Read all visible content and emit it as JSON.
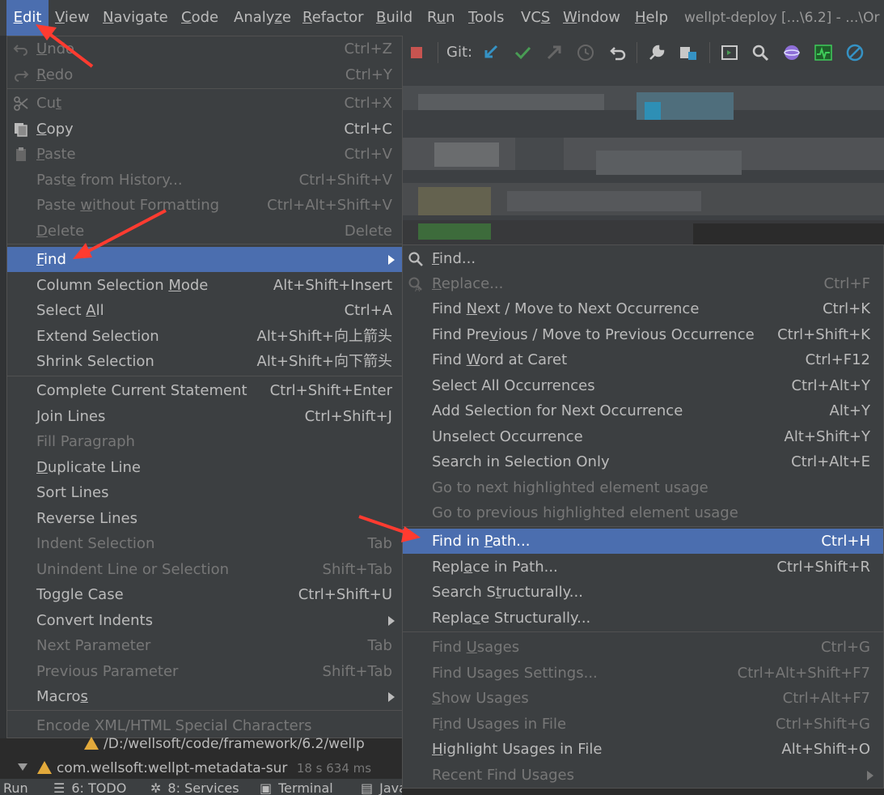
{
  "menubar": {
    "items": [
      {
        "label_u": "E",
        "label_rest": "dit",
        "active": true
      },
      {
        "label_u": "V",
        "label_rest": "iew"
      },
      {
        "label_u": "N",
        "label_rest": "avigate"
      },
      {
        "label_u": "C",
        "label_rest": "ode"
      },
      {
        "label_pre": "Analy",
        "label_u": "z",
        "label_rest": "e"
      },
      {
        "label_u": "R",
        "label_rest": "efactor"
      },
      {
        "label_u": "B",
        "label_rest": "uild"
      },
      {
        "label_pre": "R",
        "label_u": "u",
        "label_rest": "n"
      },
      {
        "label_u": "T",
        "label_rest": "ools"
      },
      {
        "label_pre": "VC",
        "label_u": "S",
        "label_rest": ""
      },
      {
        "label_u": "W",
        "label_rest": "indow"
      },
      {
        "label_u": "H",
        "label_rest": "elp"
      }
    ],
    "title": "wellpt-deploy [...\\6.2] - ...\\Or"
  },
  "toolbar": {
    "git_label": "Git:",
    "icons": [
      "stop-icon",
      "git-update-icon",
      "git-commit-icon",
      "git-push-icon",
      "git-history-icon",
      "git-rollback-icon",
      "settings-wrench-icon",
      "project-structure-icon",
      "run-anything-icon",
      "search-everywhere-icon",
      "plugin-sphere-icon",
      "activity-monitor-icon",
      "disable-icon"
    ]
  },
  "edit_menu": {
    "items": [
      {
        "pre": "",
        "u": "U",
        "rest": "ndo",
        "shortcut": "Ctrl+Z",
        "disabled": true,
        "icon": "undo-icon"
      },
      {
        "pre": "",
        "u": "R",
        "rest": "edo",
        "shortcut": "Ctrl+Y",
        "disabled": true,
        "icon": "redo-icon"
      },
      {
        "pre": "Cu",
        "u": "t",
        "rest": "",
        "shortcut": "Ctrl+X",
        "disabled": true,
        "icon": "scissors-icon"
      },
      {
        "pre": "",
        "u": "C",
        "rest": "opy",
        "shortcut": "Ctrl+C",
        "disabled": false,
        "icon": "copy-icon"
      },
      {
        "pre": "",
        "u": "P",
        "rest": "aste",
        "shortcut": "Ctrl+V",
        "disabled": true,
        "icon": "clipboard-icon"
      },
      {
        "pre": "Past",
        "u": "e",
        "rest": " from History...",
        "shortcut": "Ctrl+Shift+V",
        "disabled": true
      },
      {
        "pre": "Paste ",
        "u": "w",
        "rest": "ithout Formatting",
        "shortcut": "Ctrl+Alt+Shift+V",
        "disabled": true
      },
      {
        "pre": "",
        "u": "D",
        "rest": "elete",
        "shortcut": "Delete",
        "disabled": true
      },
      {
        "pre": "",
        "u": "F",
        "rest": "ind",
        "shortcut": "",
        "selected": true,
        "submenu": true
      },
      {
        "pre": "Column Selection ",
        "u": "M",
        "rest": "ode",
        "shortcut": "Alt+Shift+Insert"
      },
      {
        "pre": "Select ",
        "u": "A",
        "rest": "ll",
        "shortcut": "Ctrl+A"
      },
      {
        "pre": "Extend Selection",
        "u": "",
        "rest": "",
        "shortcut": "Alt+Shift+向上箭头"
      },
      {
        "pre": "Shrink Selection",
        "u": "",
        "rest": "",
        "shortcut": "Alt+Shift+向下箭头"
      },
      {
        "pre": "Complete Current Statement",
        "u": "",
        "rest": "",
        "shortcut": "Ctrl+Shift+Enter"
      },
      {
        "pre": "Join Lines",
        "u": "",
        "rest": "",
        "shortcut": "Ctrl+Shift+J"
      },
      {
        "pre": "Fill Paragraph",
        "u": "",
        "rest": "",
        "shortcut": "",
        "disabled": true
      },
      {
        "pre": "",
        "u": "D",
        "rest": "uplicate Line",
        "shortcut": ""
      },
      {
        "pre": "Sort Lines",
        "u": "",
        "rest": "",
        "shortcut": ""
      },
      {
        "pre": "Reverse Lines",
        "u": "",
        "rest": "",
        "shortcut": ""
      },
      {
        "pre": "Indent Selection",
        "u": "",
        "rest": "",
        "shortcut": "Tab",
        "disabled": true
      },
      {
        "pre": "Unindent Line or Selection",
        "u": "",
        "rest": "",
        "shortcut": "Shift+Tab",
        "disabled": true
      },
      {
        "pre": "Toggle Case",
        "u": "",
        "rest": "",
        "shortcut": "Ctrl+Shift+U"
      },
      {
        "pre": "Convert Indents",
        "u": "",
        "rest": "",
        "shortcut": "",
        "submenu": true
      },
      {
        "pre": "Next Parameter",
        "u": "",
        "rest": "",
        "shortcut": "Tab",
        "disabled": true
      },
      {
        "pre": "Previous Parameter",
        "u": "",
        "rest": "",
        "shortcut": "Shift+Tab",
        "disabled": true
      },
      {
        "pre": "Macro",
        "u": "s",
        "rest": "",
        "shortcut": "",
        "submenu": true
      },
      {
        "pre": "Encode XML/HTML Special Characters",
        "u": "",
        "rest": "",
        "shortcut": "",
        "disabled": true
      }
    ]
  },
  "find_menu": {
    "items": [
      {
        "pre": "",
        "u": "F",
        "rest": "ind...",
        "shortcut": "",
        "icon": "search-icon"
      },
      {
        "pre": "",
        "u": "R",
        "rest": "eplace...",
        "shortcut": "Ctrl+F",
        "disabled": true,
        "icon": "replace-icon"
      },
      {
        "pre": "Find ",
        "u": "N",
        "rest": "ext / Move to Next Occurrence",
        "shortcut": "Ctrl+K"
      },
      {
        "pre": "Find Pre",
        "u": "v",
        "rest": "ious / Move to Previous Occurrence",
        "shortcut": "Ctrl+Shift+K"
      },
      {
        "pre": "Find ",
        "u": "W",
        "rest": "ord at Caret",
        "shortcut": "Ctrl+F12"
      },
      {
        "pre": "Select All Occurrences",
        "u": "",
        "rest": "",
        "shortcut": "Ctrl+Alt+Y"
      },
      {
        "pre": "Add Selection for Next Occurrence",
        "u": "",
        "rest": "",
        "shortcut": "Alt+Y"
      },
      {
        "pre": "Unselect Occurrence",
        "u": "",
        "rest": "",
        "shortcut": "Alt+Shift+Y"
      },
      {
        "pre": "Search in Selection Only",
        "u": "",
        "rest": "",
        "shortcut": "Ctrl+Alt+E"
      },
      {
        "pre": "Go to next highlighted element usage",
        "u": "",
        "rest": "",
        "shortcut": "",
        "disabled": true
      },
      {
        "pre": "Go to previous highlighted element usage",
        "u": "",
        "rest": "",
        "shortcut": "",
        "disabled": true
      },
      {
        "pre": "Find in ",
        "u": "P",
        "rest": "ath...",
        "shortcut": "Ctrl+H",
        "selected": true
      },
      {
        "pre": "Repl",
        "u": "a",
        "rest": "ce in Path...",
        "shortcut": "Ctrl+Shift+R"
      },
      {
        "pre": "Search S",
        "u": "t",
        "rest": "ructurally...",
        "shortcut": ""
      },
      {
        "pre": "Repla",
        "u": "c",
        "rest": "e Structurally...",
        "shortcut": ""
      },
      {
        "pre": "Find ",
        "u": "U",
        "rest": "sages",
        "shortcut": "Ctrl+G",
        "disabled": true
      },
      {
        "pre": "Find Usages Settings...",
        "u": "",
        "rest": "",
        "shortcut": "Ctrl+Alt+Shift+F7",
        "disabled": true
      },
      {
        "pre": "",
        "u": "S",
        "rest": "how Usages",
        "shortcut": "Ctrl+Alt+F7",
        "disabled": true
      },
      {
        "pre": "F",
        "u": "i",
        "rest": "nd Usages in File",
        "shortcut": "Ctrl+Shift+G",
        "disabled": true
      },
      {
        "pre": "",
        "u": "H",
        "rest": "ighlight Usages in File",
        "shortcut": "Alt+Shift+O"
      },
      {
        "pre": "Recent Find Usages",
        "u": "",
        "rest": "",
        "shortcut": "",
        "disabled": true,
        "submenu": true
      }
    ]
  },
  "run_tree": {
    "line1": "/D:/wellsoft/code/framework/6.2/wellp",
    "line2": "com.wellsoft:wellpt-metadata-sur",
    "line2_time": "18 s 634 ms"
  },
  "statusbar": {
    "items": [
      "Run",
      "6: TODO",
      "8: Services",
      "Terminal",
      "Java"
    ]
  },
  "colors": {
    "menu_bg": "#3c3f41",
    "selection": "#4b6eaf",
    "text": "#bbbbbb",
    "disabled_text": "#777777",
    "annotation_arrow": "#ff3b30"
  }
}
